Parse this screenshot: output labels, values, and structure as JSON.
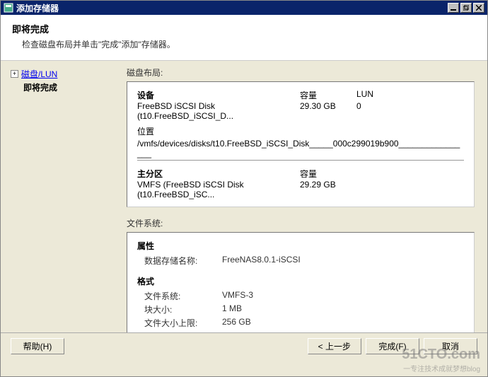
{
  "window": {
    "title": "添加存储器",
    "minimize_aria": "minimize",
    "restore_aria": "restore",
    "close_aria": "close"
  },
  "header": {
    "title": "即将完成",
    "subtitle": "检查磁盘布局并单击\"完成\"添加\"存储器。"
  },
  "nav": {
    "item1": "磁盘/LUN",
    "item2": "即将完成"
  },
  "diskLayout": {
    "section_label": "磁盘布局:",
    "device_header": "设备",
    "capacity_header": "容量",
    "lun_header": "LUN",
    "device_name": "FreeBSD iSCSI Disk (t10.FreeBSD_iSCSI_D...",
    "device_capacity": "29.30 GB",
    "device_lun": "0",
    "location_label": "位置",
    "location_path": "/vmfs/devices/disks/t10.FreeBSD_iSCSI_Disk_____000c299019b900________________",
    "partition_header": "主分区",
    "partition_capacity_header": "容量",
    "partition_name": "VMFS (FreeBSD iSCSI Disk (t10.FreeBSD_iSC...",
    "partition_capacity": "29.29 GB"
  },
  "fileSystem": {
    "section_label": "文件系统:",
    "properties_header": "属性",
    "datastore_label": "数据存储名称:",
    "datastore_value": "FreeNAS8.0.1-iSCSI",
    "format_header": "格式",
    "fs_label": "文件系统:",
    "fs_value": "VMFS-3",
    "block_label": "块大小:",
    "block_value": "1 MB",
    "maxfile_label": "文件大小上限:",
    "maxfile_value": "256 GB"
  },
  "buttons": {
    "help": "帮助(H)",
    "back": "< 上一步",
    "finish": "完成(F)",
    "cancel": "取消"
  },
  "watermark": {
    "main": "51CTO.com",
    "sub": "一专注技术成就梦想blog"
  }
}
